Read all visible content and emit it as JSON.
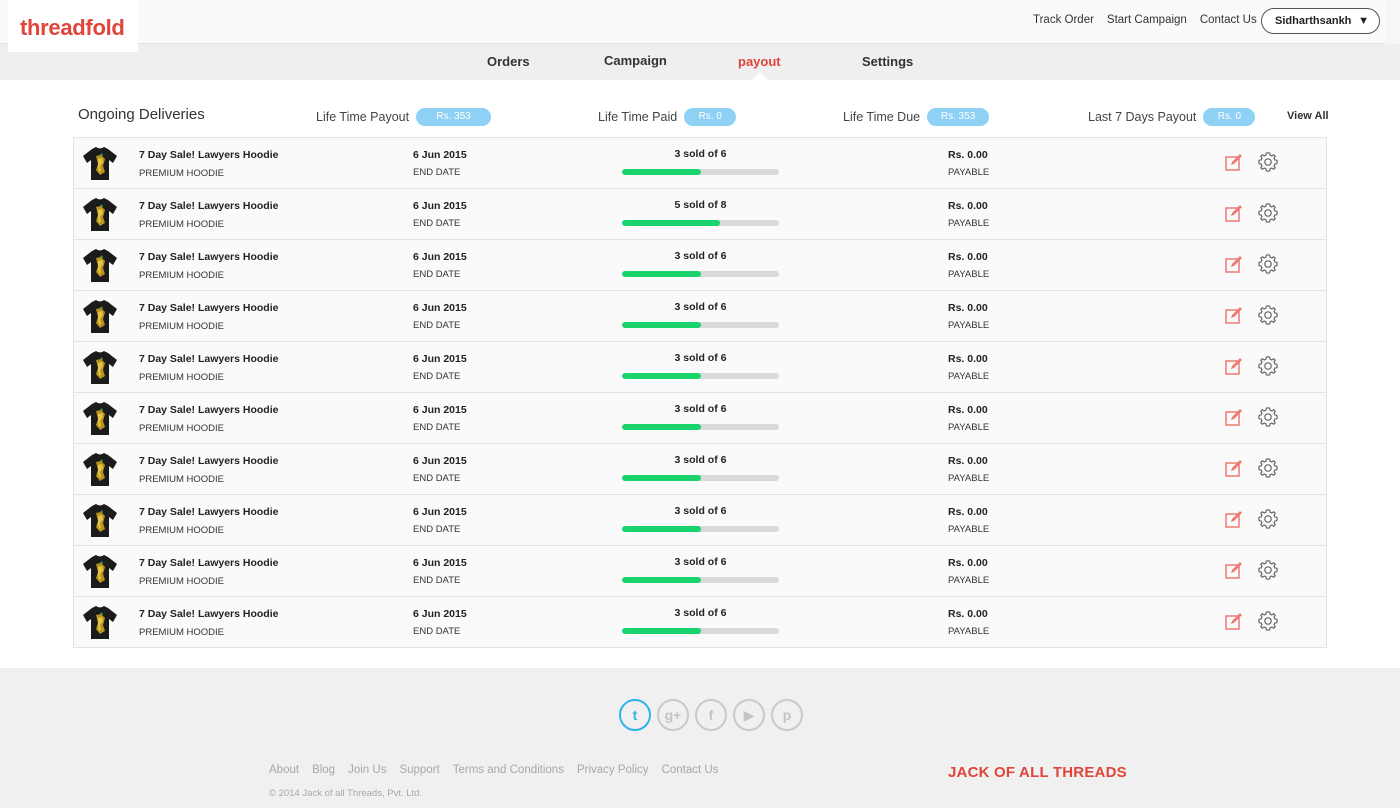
{
  "brand": {
    "logo": "threadfold"
  },
  "header": {
    "links": [
      "Track Order",
      "Start Campaign",
      "Contact Us"
    ],
    "user": "Sidharthsankh",
    "caret": "▼"
  },
  "nav": {
    "items": [
      "Orders",
      "Campaign",
      "payout",
      "Settings"
    ],
    "active": "payout"
  },
  "summary": {
    "title": "Ongoing Deliveries",
    "lifetime_payout": {
      "label": "Life Time Payout",
      "value": "Rs. 353"
    },
    "lifetime_paid": {
      "label": "Life Time Paid",
      "value": "Rs. 0"
    },
    "lifetime_due": {
      "label": "Life Time Due",
      "value": "Rs. 353"
    },
    "last7": {
      "label": "Last 7 Days Payout",
      "value": "Rs. 0"
    },
    "view_all": "View All"
  },
  "rows": [
    {
      "name": "7 Day Sale! Lawyers Hoodie",
      "category": "PREMIUM HOODIE",
      "date": "6 Jun 2015",
      "date_label": "END DATE",
      "sold_text": "3 sold of 6",
      "progress": 0.5,
      "amount": "Rs. 0.00",
      "amount_label": "PAYABLE"
    },
    {
      "name": "7 Day Sale! Lawyers Hoodie",
      "category": "PREMIUM HOODIE",
      "date": "6 Jun 2015",
      "date_label": "END DATE",
      "sold_text": "5 sold of 8",
      "progress": 0.625,
      "amount": "Rs. 0.00",
      "amount_label": "PAYABLE"
    },
    {
      "name": "7 Day Sale! Lawyers Hoodie",
      "category": "PREMIUM HOODIE",
      "date": "6 Jun 2015",
      "date_label": "END DATE",
      "sold_text": "3 sold of 6",
      "progress": 0.5,
      "amount": "Rs. 0.00",
      "amount_label": "PAYABLE"
    },
    {
      "name": "7 Day Sale! Lawyers Hoodie",
      "category": "PREMIUM HOODIE",
      "date": "6 Jun 2015",
      "date_label": "END DATE",
      "sold_text": "3 sold of 6",
      "progress": 0.5,
      "amount": "Rs. 0.00",
      "amount_label": "PAYABLE"
    },
    {
      "name": "7 Day Sale! Lawyers Hoodie",
      "category": "PREMIUM HOODIE",
      "date": "6 Jun 2015",
      "date_label": "END DATE",
      "sold_text": "3 sold of 6",
      "progress": 0.5,
      "amount": "Rs. 0.00",
      "amount_label": "PAYABLE"
    },
    {
      "name": "7 Day Sale! Lawyers Hoodie",
      "category": "PREMIUM HOODIE",
      "date": "6 Jun 2015",
      "date_label": "END DATE",
      "sold_text": "3 sold of 6",
      "progress": 0.5,
      "amount": "Rs. 0.00",
      "amount_label": "PAYABLE"
    },
    {
      "name": "7 Day Sale! Lawyers Hoodie",
      "category": "PREMIUM HOODIE",
      "date": "6 Jun 2015",
      "date_label": "END DATE",
      "sold_text": "3 sold of 6",
      "progress": 0.5,
      "amount": "Rs. 0.00",
      "amount_label": "PAYABLE"
    },
    {
      "name": "7 Day Sale! Lawyers Hoodie",
      "category": "PREMIUM HOODIE",
      "date": "6 Jun 2015",
      "date_label": "END DATE",
      "sold_text": "3 sold of 6",
      "progress": 0.5,
      "amount": "Rs. 0.00",
      "amount_label": "PAYABLE"
    },
    {
      "name": "7 Day Sale! Lawyers Hoodie",
      "category": "PREMIUM HOODIE",
      "date": "6 Jun 2015",
      "date_label": "END DATE",
      "sold_text": "3 sold of 6",
      "progress": 0.5,
      "amount": "Rs. 0.00",
      "amount_label": "PAYABLE"
    },
    {
      "name": "7 Day Sale! Lawyers Hoodie",
      "category": "PREMIUM HOODIE",
      "date": "6 Jun 2015",
      "date_label": "END DATE",
      "sold_text": "3 sold of 6",
      "progress": 0.5,
      "amount": "Rs. 0.00",
      "amount_label": "PAYABLE"
    }
  ],
  "row_icons": {
    "thumbnail": "hoodie-thumbnail",
    "edit": "edit-icon",
    "settings": "gear-icon"
  },
  "footer": {
    "socials": [
      {
        "name": "twitter-icon",
        "glyph": "t"
      },
      {
        "name": "google-plus-icon",
        "glyph": "g+"
      },
      {
        "name": "facebook-icon",
        "glyph": "f"
      },
      {
        "name": "youtube-icon",
        "glyph": "▶"
      },
      {
        "name": "pinterest-icon",
        "glyph": "p"
      }
    ],
    "links": [
      "About",
      "Blog",
      "Join Us",
      "Support",
      "Terms and Conditions",
      "Privacy Policy",
      "Contact Us"
    ],
    "copyright": "© 2014 Jack of all Threads, Pvt. Ltd.",
    "brand": "JACK OF ALL THREADS"
  },
  "colors": {
    "accent": "#e0443a",
    "pill": "#8fd0f5",
    "progress": "#19d36d",
    "twitter": "#2fb3ea"
  }
}
